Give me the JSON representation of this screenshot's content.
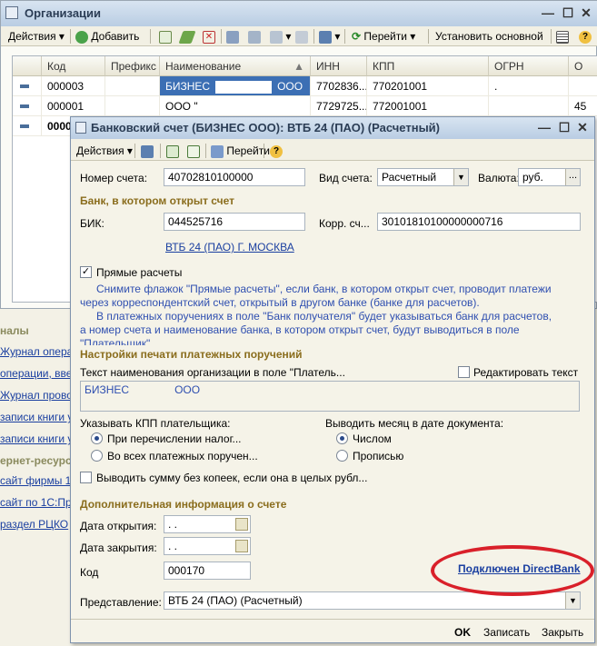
{
  "bg_window": {
    "title": "Организации",
    "toolbar": {
      "actions": "Действия",
      "add": "Добавить",
      "goto": "Перейти",
      "set_main": "Установить основной"
    },
    "columns": [
      "Код",
      "Префикс",
      "Наименование",
      "ИНН",
      "КПП",
      "ОГРН",
      "О"
    ],
    "rows": [
      {
        "code": "000003",
        "prefix": "",
        "name": "БИЗНЕС",
        "name_suffix": "ООО",
        "inn": "7702836...",
        "kpp": "770201001",
        "ogrn": ".",
        "o": ""
      },
      {
        "code": "000001",
        "prefix": "",
        "name": "ООО \"",
        "name_suffix": "",
        "inn": "7729725...",
        "kpp": "772001001",
        "ogrn": "",
        "o": "45"
      },
      {
        "code": "0000",
        "prefix": "",
        "name": "",
        "name_suffix": "",
        "inn": "",
        "kpp": "",
        "ogrn": "",
        "o": ""
      }
    ]
  },
  "left_nav": {
    "header1": "налы",
    "items1": [
      "Журнал операц",
      "операции, введ",
      "Журнал провод",
      "записи книги у",
      "записи книги у"
    ],
    "header2": "ернет-ресурс",
    "items2": [
      "сайт фирмы 1С",
      "сайт по 1С:Пре",
      "раздел РЦКО"
    ]
  },
  "dialog": {
    "title": "Банковский счет (БИЗНЕС                    ООО): ВТБ 24 (ПАО) (Расчетный)",
    "toolbar": {
      "actions": "Действия",
      "goto": "Перейти"
    },
    "account_number_label": "Номер счета:",
    "account_number": "40702810100000",
    "account_type_label": "Вид счета:",
    "account_type": "Расчетный",
    "currency_label": "Валюта:",
    "currency": "руб.",
    "bank_section": "Банк, в котором открыт счет",
    "bik_label": "БИК:",
    "bik": "044525716",
    "corr_label": "Корр. сч...",
    "corr": "30101810100000000716",
    "bank_link": "ВТБ 24 (ПАО) Г. МОСКВА",
    "direct_label": "Прямые расчеты",
    "direct_checked": true,
    "note_lines": [
      "Снимите флажок \"Прямые расчеты\", если банк, в котором открыт счет, проводит платежи",
      "через корреспондентский счет, открытый в другом банке (банке для расчетов).",
      "В платежных поручениях в поле \"Банк получателя\" будет указываться банк для расчетов,",
      "а номер счета и наименование банка, в котором открыт счет, будут выводиться в поле",
      "\"Плательщик\""
    ],
    "print_section": "Настройки печати платежных поручений",
    "org_text_label": "Текст наименования организации в поле \"Платель...",
    "edit_text_label": "Редактировать текст",
    "org_text_part1": "БИЗНЕС",
    "org_text_part2": "ООО",
    "kpp_label": "Указывать КПП плательщика:",
    "kpp_options": [
      "При перечислении налог...",
      "Во всех платежных поручен..."
    ],
    "kpp_selected": 0,
    "month_label": "Выводить месяц в дате документа:",
    "month_options": [
      "Числом",
      "Прописью"
    ],
    "month_selected": 0,
    "no_kopecks_label": "Выводить сумму без копеек, если она в целых рубл...",
    "extra_section": "Дополнительная информация о счете",
    "open_date_label": "Дата открытия:",
    "open_date": " .  .",
    "close_date_label": "Дата закрытия:",
    "close_date": " .  .",
    "code_label": "Код",
    "code": "000170",
    "directbank_link": "Подключен DirectBank",
    "representation_label": "Представление:",
    "representation": "ВТБ 24 (ПАО) (Расчетный)",
    "buttons": {
      "ok": "OK",
      "save": "Записать",
      "close": "Закрыть"
    }
  },
  "colors": {
    "highlight_ellipse": "#d9202a",
    "section_text": "#8a6d1d",
    "note_text": "#2f4fb0",
    "link": "#1a3fa0",
    "selected_cell": "#3c6fb4"
  }
}
